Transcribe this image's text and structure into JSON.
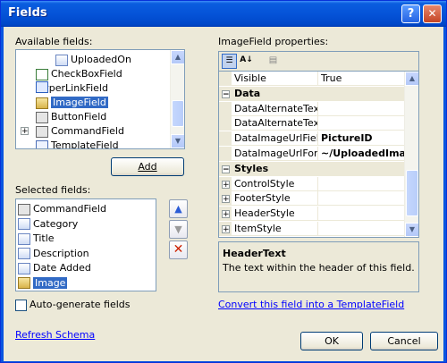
{
  "window": {
    "title": "Fields",
    "help_glyph": "?",
    "close_glyph": "✕"
  },
  "available_fields": {
    "label": "Available fields:",
    "items": [
      {
        "label": "UploadedOn",
        "icon": "bound-field-icon"
      },
      {
        "label": "CheckBoxField",
        "icon": "checkbox-field-icon"
      },
      {
        "label": "HyperLinkField",
        "icon": "hyperlink-field-icon"
      },
      {
        "label": "ImageField",
        "icon": "image-field-icon",
        "selected": true
      },
      {
        "label": "ButtonField",
        "icon": "button-field-icon"
      },
      {
        "label": "CommandField",
        "icon": "command-field-icon",
        "expandable": true
      },
      {
        "label": "TemplateField",
        "icon": "template-field-icon"
      }
    ],
    "add_label": "Add"
  },
  "selected_fields": {
    "label": "Selected fields:",
    "items": [
      {
        "label": "CommandField",
        "icon": "command-field-icon"
      },
      {
        "label": "Category",
        "icon": "bound-field-icon"
      },
      {
        "label": "Title",
        "icon": "bound-field-icon"
      },
      {
        "label": "Description",
        "icon": "bound-field-icon"
      },
      {
        "label": "Date Added",
        "icon": "bound-field-icon"
      },
      {
        "label": "Image",
        "icon": "image-field-icon",
        "selected": true
      }
    ]
  },
  "auto_generate": {
    "label": "Auto-generate fields",
    "checked": false
  },
  "refresh_schema": "Refresh Schema",
  "properties": {
    "label": "ImageField properties:",
    "rows": [
      {
        "kind": "prop",
        "name": "Visible",
        "value": "True"
      },
      {
        "kind": "category",
        "name": "Data"
      },
      {
        "kind": "prop",
        "name": "DataAlternateTextF",
        "value": ""
      },
      {
        "kind": "prop",
        "name": "DataAlternateTextF",
        "value": ""
      },
      {
        "kind": "prop",
        "name": "DataImageUrlField",
        "value": "PictureID",
        "bold": true
      },
      {
        "kind": "prop",
        "name": "DataImageUrlForma",
        "value": "~/UploadedImages",
        "bold": true
      },
      {
        "kind": "category",
        "name": "Styles"
      },
      {
        "kind": "prop",
        "name": "ControlStyle",
        "value": "",
        "expand": true
      },
      {
        "kind": "prop",
        "name": "FooterStyle",
        "value": "",
        "expand": true
      },
      {
        "kind": "prop",
        "name": "HeaderStyle",
        "value": "",
        "expand": true
      },
      {
        "kind": "prop",
        "name": "ItemStyle",
        "value": "",
        "expand": true
      }
    ],
    "help_title": "HeaderText",
    "help_text": "The text within the header of this field."
  },
  "convert_link": "Convert this field into a TemplateField",
  "buttons": {
    "ok": "OK",
    "cancel": "Cancel"
  },
  "colors": {
    "selection": "#316ac5",
    "titlebar": "#0553d8",
    "link": "#0000ff",
    "delete": "#cc2200"
  }
}
